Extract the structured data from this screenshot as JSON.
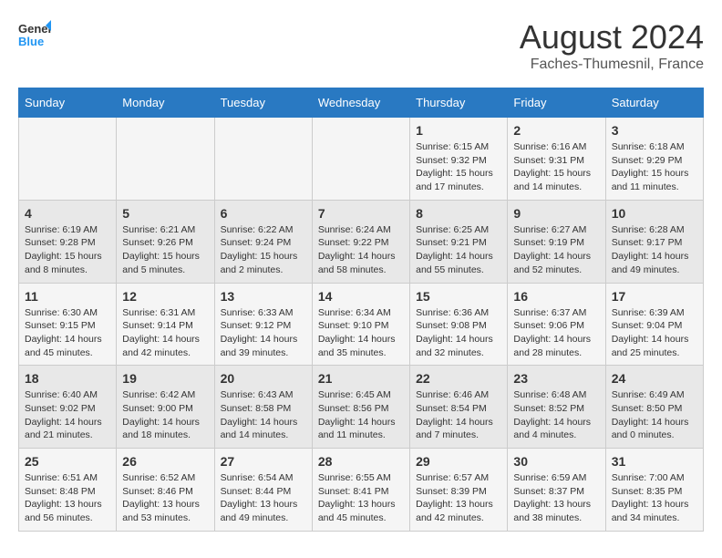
{
  "header": {
    "logo_line1": "General",
    "logo_line2": "Blue",
    "month_year": "August 2024",
    "location": "Faches-Thumesnil, France"
  },
  "weekdays": [
    "Sunday",
    "Monday",
    "Tuesday",
    "Wednesday",
    "Thursday",
    "Friday",
    "Saturday"
  ],
  "weeks": [
    [
      {
        "day": "",
        "info": ""
      },
      {
        "day": "",
        "info": ""
      },
      {
        "day": "",
        "info": ""
      },
      {
        "day": "",
        "info": ""
      },
      {
        "day": "1",
        "info": "Sunrise: 6:15 AM\nSunset: 9:32 PM\nDaylight: 15 hours and 17 minutes."
      },
      {
        "day": "2",
        "info": "Sunrise: 6:16 AM\nSunset: 9:31 PM\nDaylight: 15 hours and 14 minutes."
      },
      {
        "day": "3",
        "info": "Sunrise: 6:18 AM\nSunset: 9:29 PM\nDaylight: 15 hours and 11 minutes."
      }
    ],
    [
      {
        "day": "4",
        "info": "Sunrise: 6:19 AM\nSunset: 9:28 PM\nDaylight: 15 hours and 8 minutes."
      },
      {
        "day": "5",
        "info": "Sunrise: 6:21 AM\nSunset: 9:26 PM\nDaylight: 15 hours and 5 minutes."
      },
      {
        "day": "6",
        "info": "Sunrise: 6:22 AM\nSunset: 9:24 PM\nDaylight: 15 hours and 2 minutes."
      },
      {
        "day": "7",
        "info": "Sunrise: 6:24 AM\nSunset: 9:22 PM\nDaylight: 14 hours and 58 minutes."
      },
      {
        "day": "8",
        "info": "Sunrise: 6:25 AM\nSunset: 9:21 PM\nDaylight: 14 hours and 55 minutes."
      },
      {
        "day": "9",
        "info": "Sunrise: 6:27 AM\nSunset: 9:19 PM\nDaylight: 14 hours and 52 minutes."
      },
      {
        "day": "10",
        "info": "Sunrise: 6:28 AM\nSunset: 9:17 PM\nDaylight: 14 hours and 49 minutes."
      }
    ],
    [
      {
        "day": "11",
        "info": "Sunrise: 6:30 AM\nSunset: 9:15 PM\nDaylight: 14 hours and 45 minutes."
      },
      {
        "day": "12",
        "info": "Sunrise: 6:31 AM\nSunset: 9:14 PM\nDaylight: 14 hours and 42 minutes."
      },
      {
        "day": "13",
        "info": "Sunrise: 6:33 AM\nSunset: 9:12 PM\nDaylight: 14 hours and 39 minutes."
      },
      {
        "day": "14",
        "info": "Sunrise: 6:34 AM\nSunset: 9:10 PM\nDaylight: 14 hours and 35 minutes."
      },
      {
        "day": "15",
        "info": "Sunrise: 6:36 AM\nSunset: 9:08 PM\nDaylight: 14 hours and 32 minutes."
      },
      {
        "day": "16",
        "info": "Sunrise: 6:37 AM\nSunset: 9:06 PM\nDaylight: 14 hours and 28 minutes."
      },
      {
        "day": "17",
        "info": "Sunrise: 6:39 AM\nSunset: 9:04 PM\nDaylight: 14 hours and 25 minutes."
      }
    ],
    [
      {
        "day": "18",
        "info": "Sunrise: 6:40 AM\nSunset: 9:02 PM\nDaylight: 14 hours and 21 minutes."
      },
      {
        "day": "19",
        "info": "Sunrise: 6:42 AM\nSunset: 9:00 PM\nDaylight: 14 hours and 18 minutes."
      },
      {
        "day": "20",
        "info": "Sunrise: 6:43 AM\nSunset: 8:58 PM\nDaylight: 14 hours and 14 minutes."
      },
      {
        "day": "21",
        "info": "Sunrise: 6:45 AM\nSunset: 8:56 PM\nDaylight: 14 hours and 11 minutes."
      },
      {
        "day": "22",
        "info": "Sunrise: 6:46 AM\nSunset: 8:54 PM\nDaylight: 14 hours and 7 minutes."
      },
      {
        "day": "23",
        "info": "Sunrise: 6:48 AM\nSunset: 8:52 PM\nDaylight: 14 hours and 4 minutes."
      },
      {
        "day": "24",
        "info": "Sunrise: 6:49 AM\nSunset: 8:50 PM\nDaylight: 14 hours and 0 minutes."
      }
    ],
    [
      {
        "day": "25",
        "info": "Sunrise: 6:51 AM\nSunset: 8:48 PM\nDaylight: 13 hours and 56 minutes."
      },
      {
        "day": "26",
        "info": "Sunrise: 6:52 AM\nSunset: 8:46 PM\nDaylight: 13 hours and 53 minutes."
      },
      {
        "day": "27",
        "info": "Sunrise: 6:54 AM\nSunset: 8:44 PM\nDaylight: 13 hours and 49 minutes."
      },
      {
        "day": "28",
        "info": "Sunrise: 6:55 AM\nSunset: 8:41 PM\nDaylight: 13 hours and 45 minutes."
      },
      {
        "day": "29",
        "info": "Sunrise: 6:57 AM\nSunset: 8:39 PM\nDaylight: 13 hours and 42 minutes."
      },
      {
        "day": "30",
        "info": "Sunrise: 6:59 AM\nSunset: 8:37 PM\nDaylight: 13 hours and 38 minutes."
      },
      {
        "day": "31",
        "info": "Sunrise: 7:00 AM\nSunset: 8:35 PM\nDaylight: 13 hours and 34 minutes."
      }
    ]
  ]
}
